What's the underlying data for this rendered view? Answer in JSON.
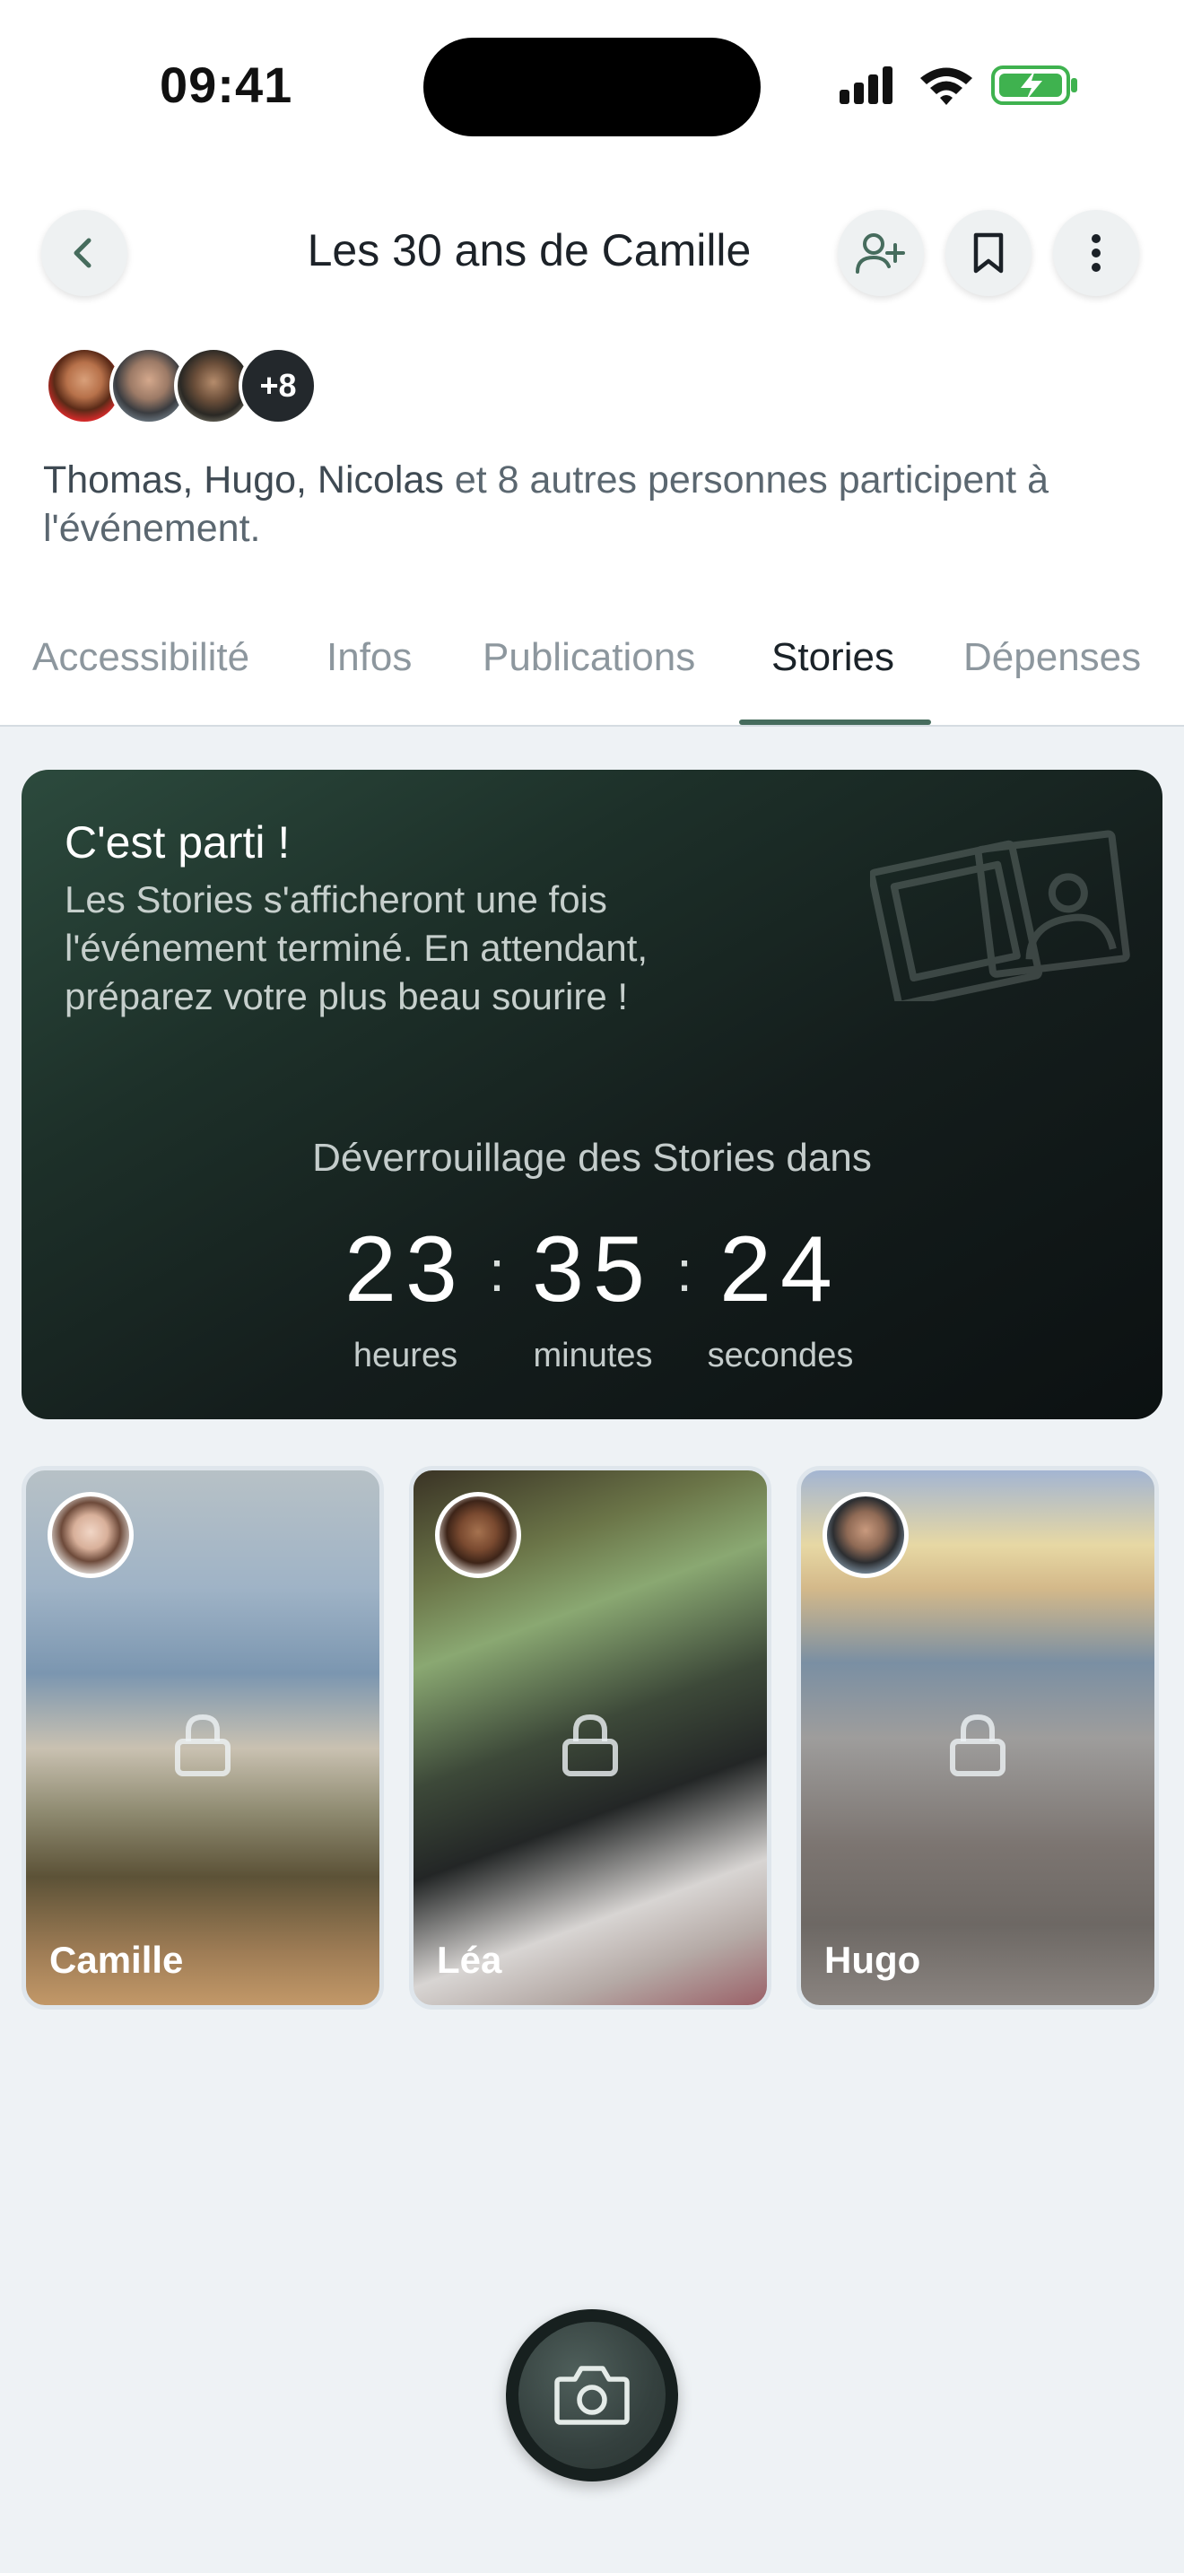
{
  "status_bar": {
    "time": "09:41"
  },
  "header": {
    "title": "Les 30 ans de Camille",
    "back_icon": "chevron-left-icon",
    "invite_icon": "user-plus-icon",
    "bookmark_icon": "bookmark-icon",
    "more_icon": "more-vertical-icon"
  },
  "participants": {
    "more_badge": "+8",
    "names": "Thomas, Hugo, Nicolas",
    "rest": " et 8 autres personnes participent à l'événement."
  },
  "tabs": [
    {
      "label": "Accessibilité",
      "active": false
    },
    {
      "label": "Infos",
      "active": false
    },
    {
      "label": "Publications",
      "active": false
    },
    {
      "label": "Stories",
      "active": true
    },
    {
      "label": "Dépenses",
      "active": false
    }
  ],
  "hero": {
    "title": "C'est parti !",
    "description": "Les Stories s'afficheront une fois l'événement terminé. En attendant, préparez votre plus beau sourire !",
    "countdown_label": "Déverrouillage des Stories dans",
    "hours": "23",
    "minutes": "35",
    "seconds": "24",
    "hours_label": "heures",
    "minutes_label": "minutes",
    "seconds_label": "secondes",
    "separator": ":"
  },
  "stories": [
    {
      "name": "Camille",
      "locked": true
    },
    {
      "name": "Léa",
      "locked": true
    },
    {
      "name": "Hugo",
      "locked": true
    }
  ],
  "camera_button": {
    "icon": "camera-icon"
  },
  "colors": {
    "accent": "#466c5d",
    "background": "#eef2f5",
    "hero_dark": "#0c1112"
  }
}
